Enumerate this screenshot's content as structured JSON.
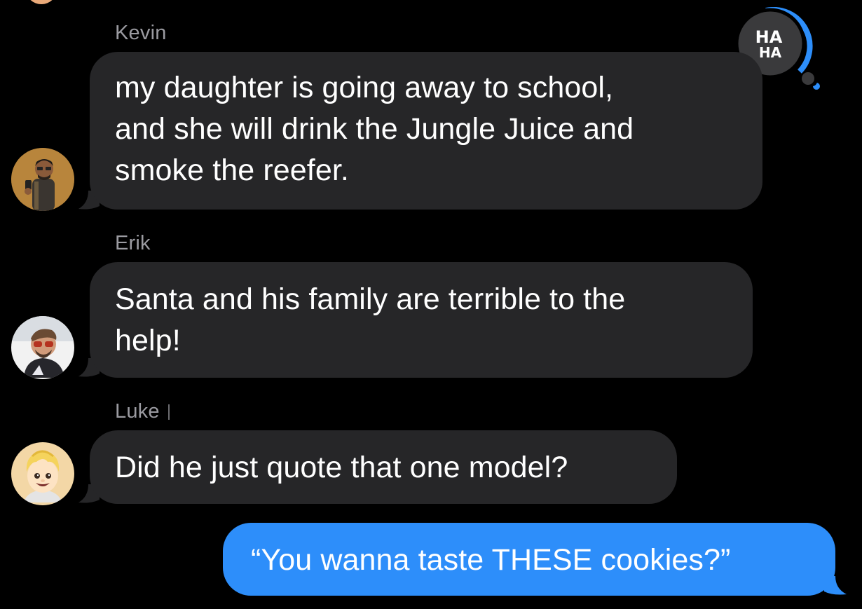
{
  "conversation": {
    "messages": [
      {
        "sender": "Kevin",
        "text": "my daughter is going away to school,\nand she will drink the Jungle Juice and\nsmoke the reefer.",
        "direction": "incoming",
        "avatar_icon": "kevin-avatar",
        "tapback": {
          "label_line1": "HA",
          "label_line2": "HA",
          "icon": "haha-tapback-icon",
          "accent_color": "#2d8efa"
        }
      },
      {
        "sender": "Erik",
        "text": "Santa and his family are terrible to the\nhelp!",
        "direction": "incoming",
        "avatar_icon": "erik-avatar"
      },
      {
        "sender": "Luke",
        "text": "Did he just quote that one model?",
        "direction": "incoming",
        "avatar_icon": "memoji-avatar"
      },
      {
        "sender": "",
        "text": "“You wanna taste THESE cookies?”",
        "direction": "outgoing"
      }
    ]
  },
  "colors": {
    "background": "#000000",
    "incoming_bubble": "#262628",
    "outgoing_bubble": "#2d8efa",
    "sender_name": "#9b9ba1",
    "message_text": "#ffffff"
  }
}
